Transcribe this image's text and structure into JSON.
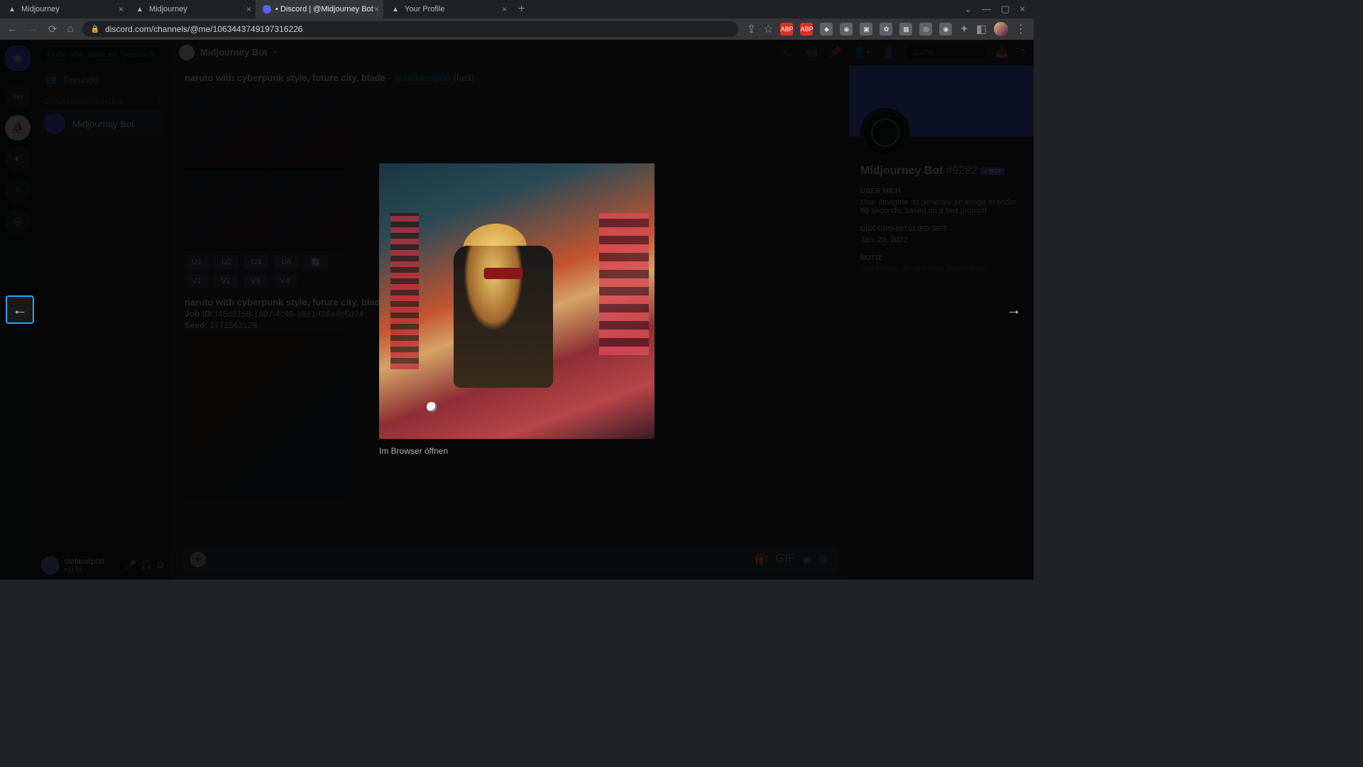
{
  "browser": {
    "tabs": [
      {
        "title": "Midjourney"
      },
      {
        "title": "Midjourney"
      },
      {
        "title": "• Discord | @Midjourney Bot"
      },
      {
        "title": "Your Profile"
      }
    ],
    "active_tab_index": 2,
    "url": "discord.com/channels/@me/1063443749197316226"
  },
  "discord": {
    "dm_search_placeholder": "Finde oder starte ein Gespräch",
    "friends_label": "Freunde",
    "dm_header": "DIREKTNACHRICHTEN",
    "dm_selected": "Midjourney Bot",
    "channel_title": "Midjourney Bot",
    "search_placeholder": "Suche",
    "user": {
      "name": "stefanstp08",
      "discrim": "#3179"
    }
  },
  "messages": {
    "msg1": {
      "prompt": "naruto with cyberpunk style, future city, blade",
      "author": "@stefanstp08",
      "mode": "(fast)",
      "u_buttons": [
        "U1",
        "U2",
        "U3",
        "U4"
      ],
      "v_buttons": [
        "V1",
        "V2",
        "V3",
        "V4"
      ]
    },
    "msg2": {
      "prompt": "naruto with cyberpunk style, future city, blade",
      "job_label": "Job ID",
      "job_id": "f45d8158-1a07-4c49-a8e1-f28a4b6d24",
      "seed_label": "Seed",
      "seed": "1772563128"
    }
  },
  "right_panel": {
    "name": "Midjourney Bot",
    "tag": "#9282",
    "badge": "✓ BOT",
    "about_header": "ÜBER MICH",
    "about_text_pre": "Use ",
    "about_cmd": "/imagine",
    "about_text_post": " to generate an image in under 60 seconds, based on a text prompt!",
    "member_header": "DISCORD-MITGLIED SEIT",
    "member_since": "Jan. 29, 2022",
    "note_header": "NOTIZ",
    "note_placeholder": "Hier klicken, um eine Notiz hinzuzufügen"
  },
  "lightbox": {
    "open_link": "Im Browser öffnen"
  }
}
